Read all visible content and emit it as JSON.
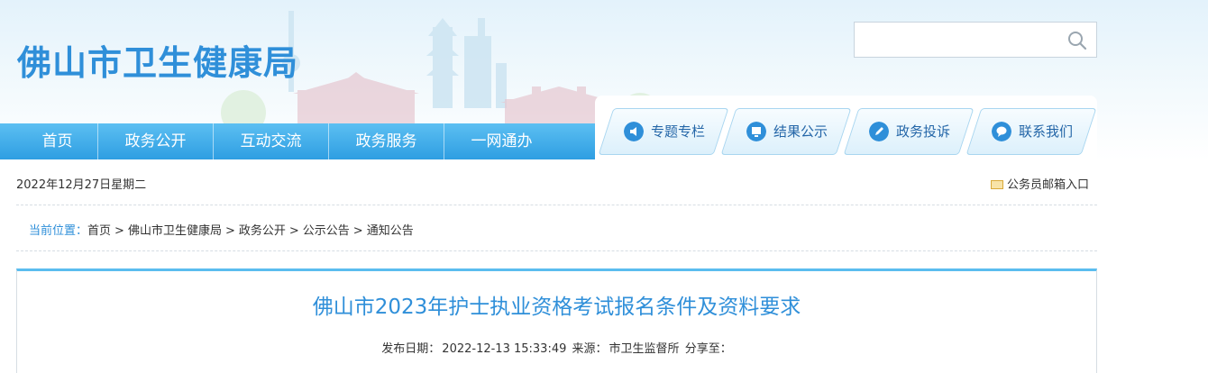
{
  "site": {
    "title": "佛山市卫生健康局"
  },
  "search": {
    "placeholder": ""
  },
  "nav": {
    "items": [
      {
        "label": "首页"
      },
      {
        "label": "政务公开"
      },
      {
        "label": "互动交流"
      },
      {
        "label": "政务服务"
      },
      {
        "label": "一网通办"
      }
    ]
  },
  "quick_links": [
    {
      "label": "专题专栏",
      "icon": "speaker-icon"
    },
    {
      "label": "结果公示",
      "icon": "monitor-icon"
    },
    {
      "label": "政务投诉",
      "icon": "pen-icon"
    },
    {
      "label": "联系我们",
      "icon": "chat-icon"
    }
  ],
  "date_text": "2022年12月27日星期二",
  "mail_link": "公务员邮箱入口",
  "breadcrumb": {
    "lead": "当前位置：",
    "items": [
      "首页",
      "佛山市卫生健康局",
      "政务公开",
      "公示公告",
      "通知公告"
    ]
  },
  "article": {
    "title": "佛山市2023年护士执业资格考试报名条件及资料要求",
    "publish_label": "发布日期：",
    "publish_date": "2022-12-13 15:33:49",
    "source_label": "来源：",
    "source": "市卫生监督所",
    "share_label": "分享至："
  },
  "colors": {
    "brand_blue": "#2f8fd9",
    "nav_blue": "#3aa8e8"
  }
}
